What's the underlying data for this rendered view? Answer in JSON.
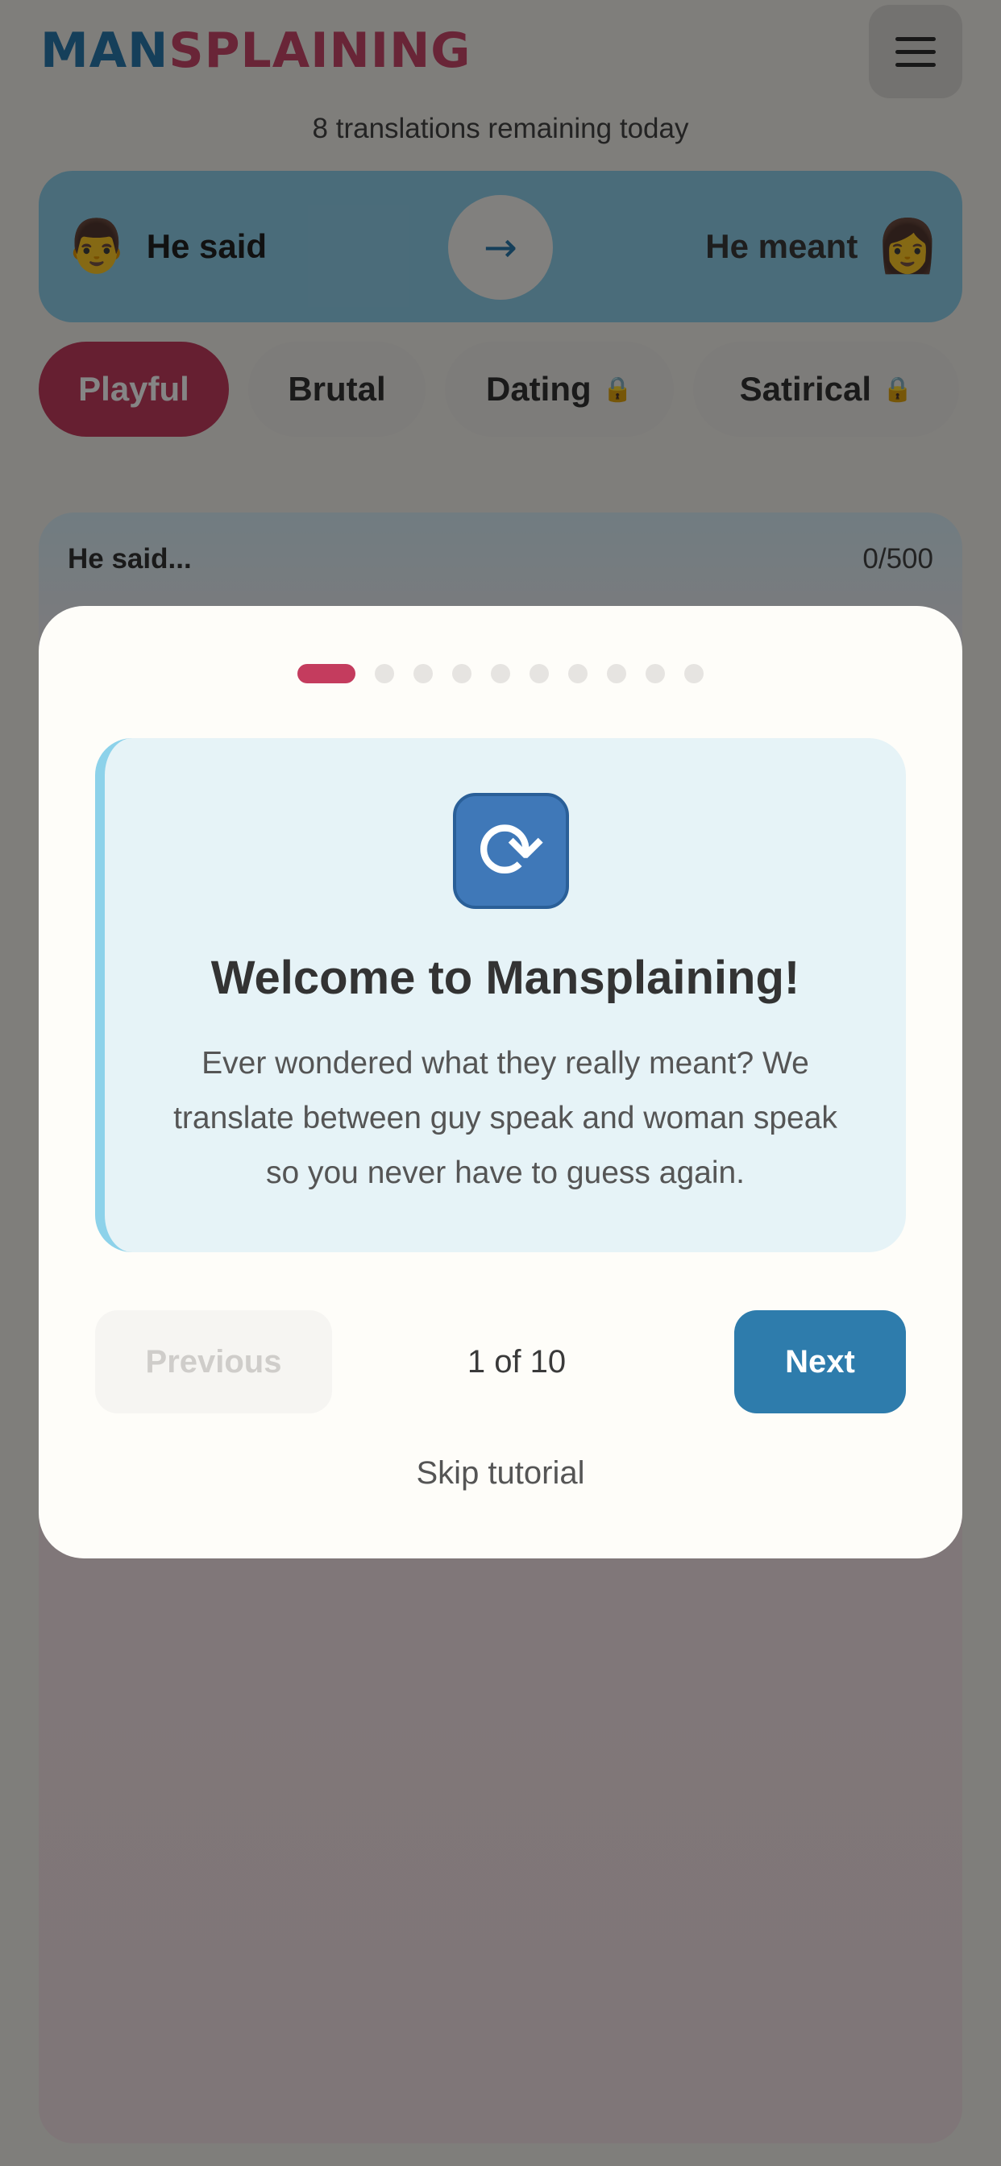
{
  "app": {
    "logo_part1": "MAN",
    "logo_part2": "SPLAINING",
    "remaining": "8 translations remaining today",
    "brand_blue": "#2a79ad",
    "brand_pink": "#c9486a"
  },
  "direction": {
    "left_label": "He said",
    "right_label": "He meant",
    "left_icon": "man-face-icon",
    "right_icon": "woman-face-icon",
    "swap_icon": "arrow-right-icon"
  },
  "tones": [
    {
      "label": "Playful",
      "active": true,
      "locked": false
    },
    {
      "label": "Brutal",
      "active": false,
      "locked": false
    },
    {
      "label": "Dating",
      "active": false,
      "locked": true
    },
    {
      "label": "Satirical",
      "active": false,
      "locked": true
    }
  ],
  "input": {
    "label": "He said...",
    "counter": "0/500"
  },
  "tutorial": {
    "total_steps": 10,
    "current_step": 1,
    "icon": "refresh-arrows-icon",
    "title": "Welcome to Mansplaining!",
    "text": "Ever wondered what they really meant? We translate between guy speak and woman speak so you never have to guess again.",
    "previous_label": "Previous",
    "counter": "1 of 10",
    "next_label": "Next",
    "skip_label": "Skip tutorial",
    "accent": "#c43c5e",
    "next_color": "#2e7cac"
  }
}
